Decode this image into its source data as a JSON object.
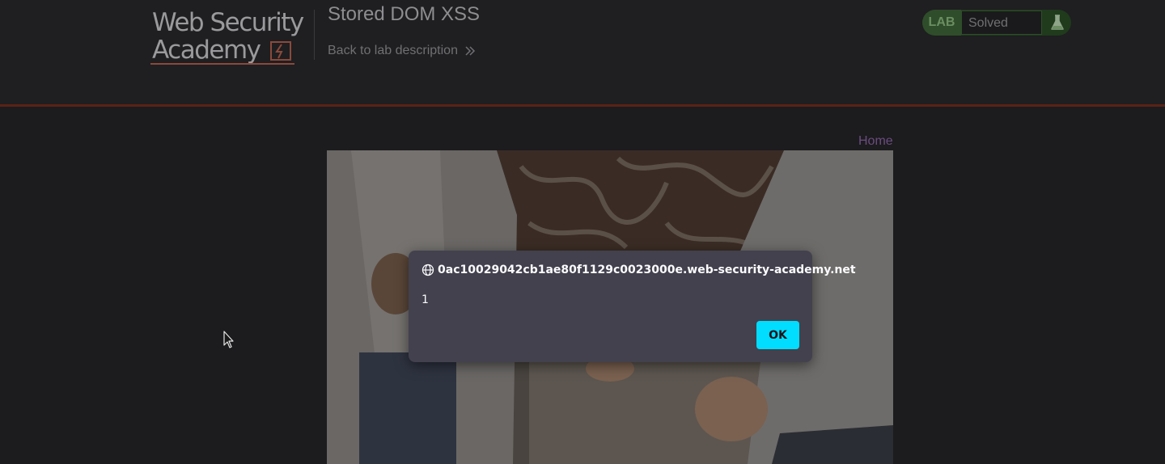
{
  "header": {
    "logo": {
      "line1": "Web Security",
      "line2": "Academy"
    },
    "lab_title": "Stored DOM XSS",
    "back_link_label": "Back to lab description",
    "status": {
      "badge": "LAB",
      "value": "Solved",
      "icon": "flask-icon"
    }
  },
  "nav": {
    "home_label": "Home"
  },
  "dialog": {
    "origin": "0ac10029042cb1ae80f1129c0023000e.web-security-academy.net",
    "message": "1",
    "ok_label": "OK"
  },
  "colors": {
    "background": "#1c1b1e",
    "dialog_bg": "#42414d",
    "ok_button": "#00ddff",
    "solved_green": "#2f4d2a",
    "header_border": "#5a2315"
  }
}
